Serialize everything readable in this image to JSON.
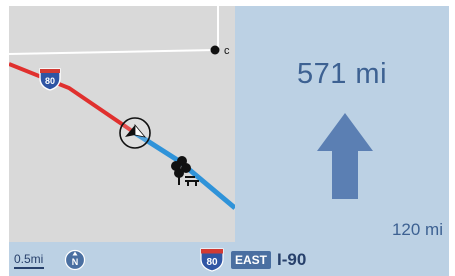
{
  "map": {
    "highway_shield_number": "80",
    "route_colors": {
      "traveled": "#e0302e",
      "upcoming": "#2f93d9",
      "road": "#ffffff",
      "background": "#d9d9d9"
    },
    "icons": [
      "vehicle-position-icon",
      "rest-area-icon",
      "poi-marker-icon"
    ]
  },
  "guidance": {
    "next_distance": "571 mi",
    "maneuver": "straight-arrow-icon",
    "secondary_distance": "120 mi",
    "accent_color": "#5b7fb3",
    "panel_color": "#bcd1e4"
  },
  "bottom_bar": {
    "scale_label": "0.5mi",
    "compass_label": "N",
    "route_shield": "80",
    "direction": "EAST",
    "road_name": "I-90"
  }
}
